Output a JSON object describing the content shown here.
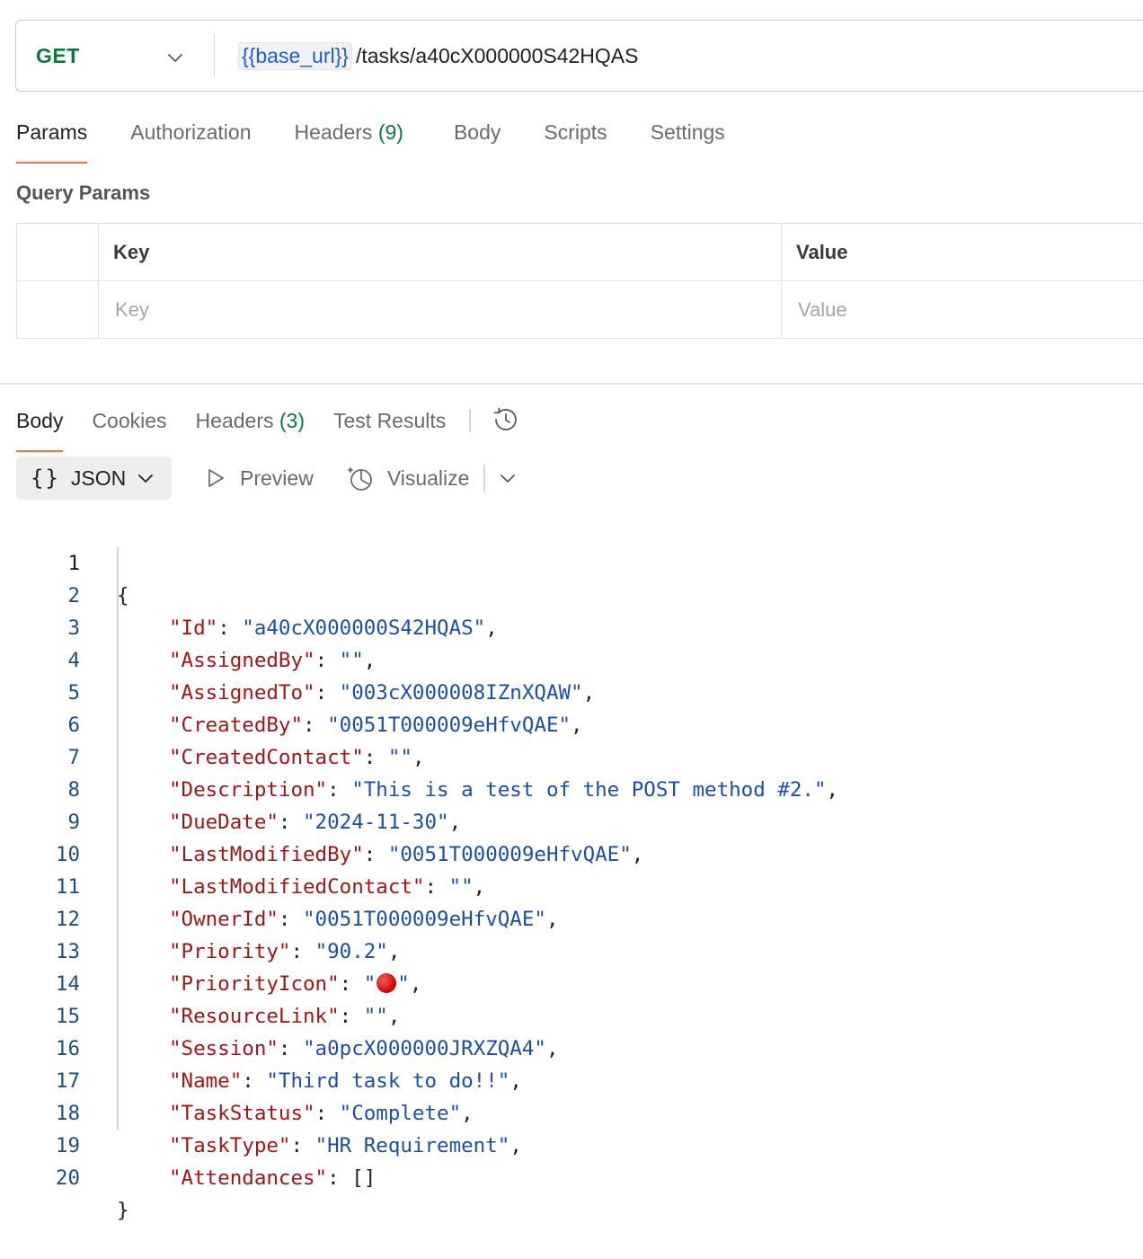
{
  "request": {
    "method": "GET",
    "url_variable": "{{base_url}}",
    "url_path": "/tasks/a40cX000000S42HQAS"
  },
  "request_tabs": [
    {
      "label": "Params",
      "count": ""
    },
    {
      "label": "Authorization",
      "count": ""
    },
    {
      "label": "Headers",
      "count": "(9)"
    },
    {
      "label": "Body",
      "count": ""
    },
    {
      "label": "Scripts",
      "count": ""
    },
    {
      "label": "Settings",
      "count": ""
    }
  ],
  "query_params": {
    "title": "Query Params",
    "header_key": "Key",
    "header_value": "Value",
    "placeholder_key": "Key",
    "placeholder_value": "Value"
  },
  "response_tabs": [
    {
      "label": "Body",
      "count": ""
    },
    {
      "label": "Cookies",
      "count": ""
    },
    {
      "label": "Headers",
      "count": "(3)"
    },
    {
      "label": "Test Results",
      "count": ""
    }
  ],
  "toolbar": {
    "format_label": "JSON",
    "preview_label": "Preview",
    "visualize_label": "Visualize"
  },
  "response_json": {
    "open": "{",
    "close": "}",
    "fields": [
      {
        "key": "\"Id\"",
        "value": "\"a40cX000000S42HQAS\""
      },
      {
        "key": "\"AssignedBy\"",
        "value": "\"\""
      },
      {
        "key": "\"AssignedTo\"",
        "value": "\"003cX000008IZnXQAW\""
      },
      {
        "key": "\"CreatedBy\"",
        "value": "\"0051T000009eHfvQAE\""
      },
      {
        "key": "\"CreatedContact\"",
        "value": "\"\""
      },
      {
        "key": "\"Description\"",
        "value": "\"This is a test of the POST method #2.\""
      },
      {
        "key": "\"DueDate\"",
        "value": "\"2024-11-30\""
      },
      {
        "key": "\"LastModifiedBy\"",
        "value": "\"0051T000009eHfvQAE\""
      },
      {
        "key": "\"LastModifiedContact\"",
        "value": "\"\""
      },
      {
        "key": "\"OwnerId\"",
        "value": "\"0051T000009eHfvQAE\""
      },
      {
        "key": "\"Priority\"",
        "value": "\"90.2\""
      },
      {
        "key": "\"PriorityIcon\"",
        "value": "\"🔴\""
      },
      {
        "key": "\"ResourceLink\"",
        "value": "\"\""
      },
      {
        "key": "\"Session\"",
        "value": "\"a0pcX000000JRXZQA4\""
      },
      {
        "key": "\"Name\"",
        "value": "\"Third task to do!!\""
      },
      {
        "key": "\"TaskStatus\"",
        "value": "\"Complete\""
      },
      {
        "key": "\"TaskType\"",
        "value": "\"HR Requirement\""
      },
      {
        "key": "\"Attendances\"",
        "value": "[]"
      }
    ]
  },
  "colors": {
    "method": "#0b7a3b",
    "url_variable": "#1e5bd8",
    "active_tab_underline": "#ff6c37",
    "json_key": "#a31515",
    "json_string": "#1c4ea8",
    "priority_icon": "#d10000"
  },
  "icons": {
    "method_dropdown": "chevron-down-icon",
    "history": "history-icon",
    "format_dropdown": "chevron-down-icon",
    "preview": "play-icon",
    "visualize": "visualize-icon",
    "more": "chevron-down-icon"
  }
}
